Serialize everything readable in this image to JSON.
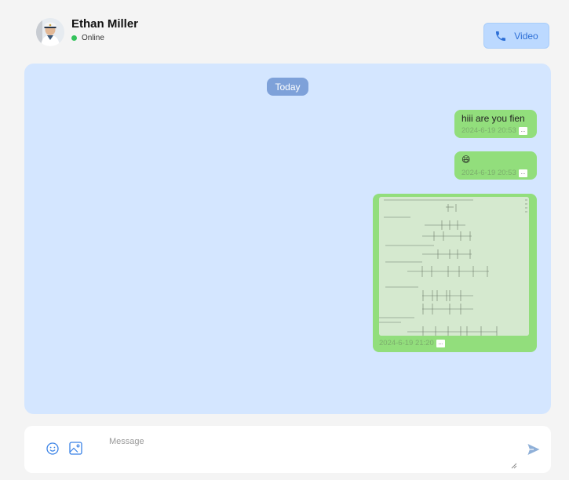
{
  "header": {
    "contact_name": "Ethan Miller",
    "status": "Online",
    "status_color": "#33c25b",
    "video_label": "Video",
    "video_icon": "phone-icon"
  },
  "chat": {
    "date_divider": "Today",
    "messages": [
      {
        "type": "text",
        "text": "hiii are you fien",
        "timestamp": "2024-6-19 20:53",
        "more": "..."
      },
      {
        "type": "emoji",
        "text": "😄",
        "timestamp": "2024-6-19 20:53",
        "more": "..."
      },
      {
        "type": "image",
        "image_content": "screenshot of handwritten math document with matrices",
        "timestamp": "2024-6-19 21:20",
        "more": "..."
      }
    ]
  },
  "composer": {
    "placeholder": "Message",
    "emoji_icon": "smiley-icon",
    "image_icon": "image-icon",
    "send_icon": "send-icon"
  },
  "colors": {
    "page_bg": "#f4f4f4",
    "chat_bg": "#d4e6ff",
    "bubble_bg": "#92de7c",
    "accent": "#2d6fd6",
    "date_pill_bg": "#7ea1d9"
  }
}
